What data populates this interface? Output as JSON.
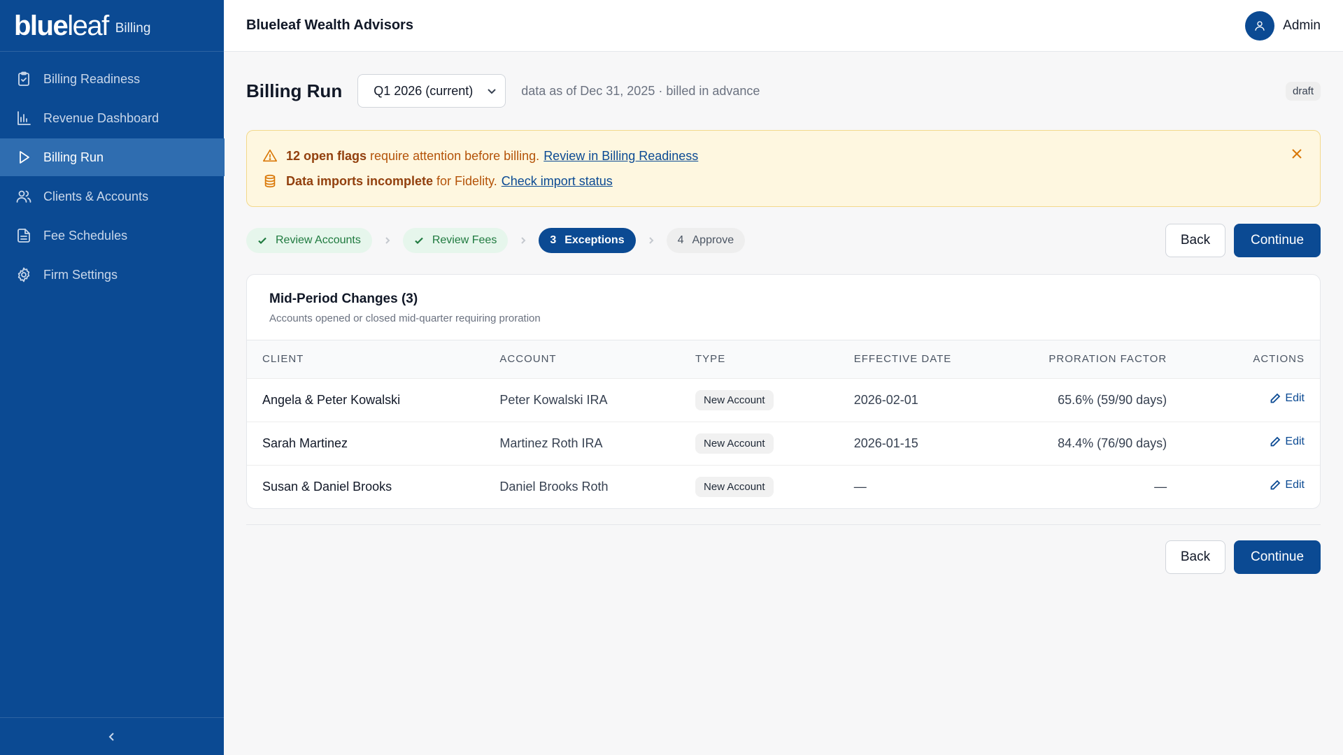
{
  "brand": {
    "logo_bold": "blue",
    "logo_light": "leaf",
    "product": "Billing"
  },
  "sidebar": {
    "items": [
      {
        "label": "Billing Readiness",
        "icon": "clipboard-check-icon",
        "active": false
      },
      {
        "label": "Revenue Dashboard",
        "icon": "bar-chart-icon",
        "active": false
      },
      {
        "label": "Billing Run",
        "icon": "play-icon",
        "active": true
      },
      {
        "label": "Clients & Accounts",
        "icon": "users-icon",
        "active": false
      },
      {
        "label": "Fee Schedules",
        "icon": "document-icon",
        "active": false
      },
      {
        "label": "Firm Settings",
        "icon": "gear-icon",
        "active": false
      }
    ],
    "collapse_icon": "chevron-left-icon"
  },
  "topbar": {
    "firm_name": "Blueleaf Wealth Advisors",
    "user_label": "Admin",
    "avatar_icon": "user-icon"
  },
  "header": {
    "title": "Billing Run",
    "period_select": "Q1 2026 (current)",
    "meta": "data as of Dec 31, 2025 · billed in advance",
    "status_badge": "draft"
  },
  "alert": {
    "line1": {
      "strong": "12 open flags",
      "text": "require attention before billing.",
      "link": "Review in Billing Readiness"
    },
    "line2": {
      "strong": "Data imports incomplete",
      "text": "for Fidelity.",
      "link": "Check import status"
    }
  },
  "stepper": {
    "steps": [
      {
        "label": "Review Accounts",
        "state": "done"
      },
      {
        "label": "Review Fees",
        "state": "done"
      },
      {
        "num": "3",
        "label": "Exceptions",
        "state": "current"
      },
      {
        "num": "4",
        "label": "Approve",
        "state": "todo"
      }
    ]
  },
  "buttons": {
    "back": "Back",
    "continue": "Continue"
  },
  "card": {
    "title": "Mid-Period Changes (3)",
    "subtitle": "Accounts opened or closed mid-quarter requiring proration",
    "columns": [
      "CLIENT",
      "ACCOUNT",
      "TYPE",
      "EFFECTIVE DATE",
      "PRORATION FACTOR",
      "ACTIONS"
    ],
    "rows": [
      {
        "client": "Angela & Peter Kowalski",
        "account": "Peter Kowalski IRA",
        "type": "New Account",
        "effective_date": "2026-02-01",
        "proration": "65.6% (59/90 days)",
        "action": "Edit"
      },
      {
        "client": "Sarah Martinez",
        "account": "Martinez Roth IRA",
        "type": "New Account",
        "effective_date": "2026-01-15",
        "proration": "84.4% (76/90 days)",
        "action": "Edit"
      },
      {
        "client": "Susan & Daniel Brooks",
        "account": "Daniel Brooks Roth",
        "type": "New Account",
        "effective_date": "—",
        "proration": "—",
        "action": "Edit"
      }
    ]
  },
  "colors": {
    "primary": "#0b4a93",
    "sidebar_active": "#2f6db0",
    "alert_bg": "#fef7e0",
    "alert_text": "#92400e",
    "success": "#1f7a3f"
  }
}
